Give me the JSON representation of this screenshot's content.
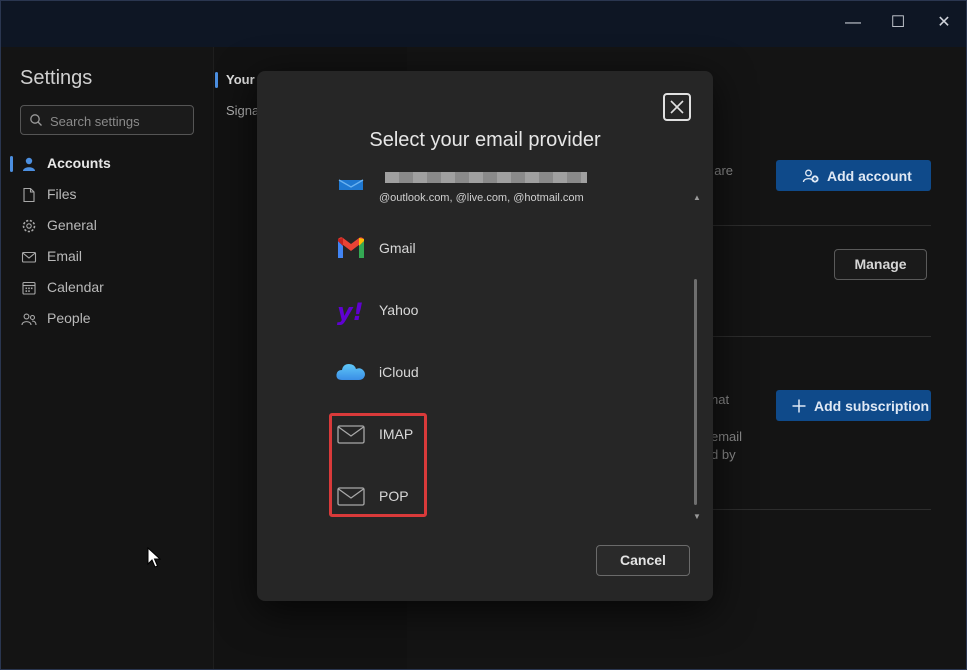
{
  "window": {
    "controls": {
      "minimize": "—",
      "maximize": "☐",
      "close": "✕"
    }
  },
  "sidebar": {
    "title": "Settings",
    "search": {
      "placeholder": "Search settings",
      "value": ""
    },
    "items": [
      {
        "label": "Accounts",
        "icon": "person-icon",
        "active": true
      },
      {
        "label": "Files",
        "icon": "file-icon"
      },
      {
        "label": "General",
        "icon": "gear-icon"
      },
      {
        "label": "Email",
        "icon": "mail-icon"
      },
      {
        "label": "Calendar",
        "icon": "calendar-icon"
      },
      {
        "label": "People",
        "icon": "people-icon"
      }
    ]
  },
  "subnav": {
    "items": [
      {
        "label": "Your"
      },
      {
        "label": "Signa"
      }
    ]
  },
  "main": {
    "add_account_label": "Add account",
    "manage_label": "Manage",
    "add_subscription_label": "Add subscription",
    "fragments": [
      "t are",
      "hat",
      "email",
      "d by"
    ]
  },
  "modal": {
    "title": "Select your email provider",
    "providers": [
      {
        "name": "",
        "subtitle": "@outlook.com, @live.com, @hotmail.com",
        "icon": "outlook-icon"
      },
      {
        "name": "Gmail",
        "icon": "gmail-icon"
      },
      {
        "name": "Yahoo",
        "icon": "yahoo-icon"
      },
      {
        "name": "iCloud",
        "icon": "icloud-icon"
      },
      {
        "name": "IMAP",
        "icon": "envelope-icon"
      },
      {
        "name": "POP",
        "icon": "envelope-icon"
      }
    ],
    "cancel_label": "Cancel",
    "colors": {
      "highlight": "#d93a3a",
      "accent": "#4c8fe0",
      "primary_button": "#0f4a8a"
    }
  }
}
